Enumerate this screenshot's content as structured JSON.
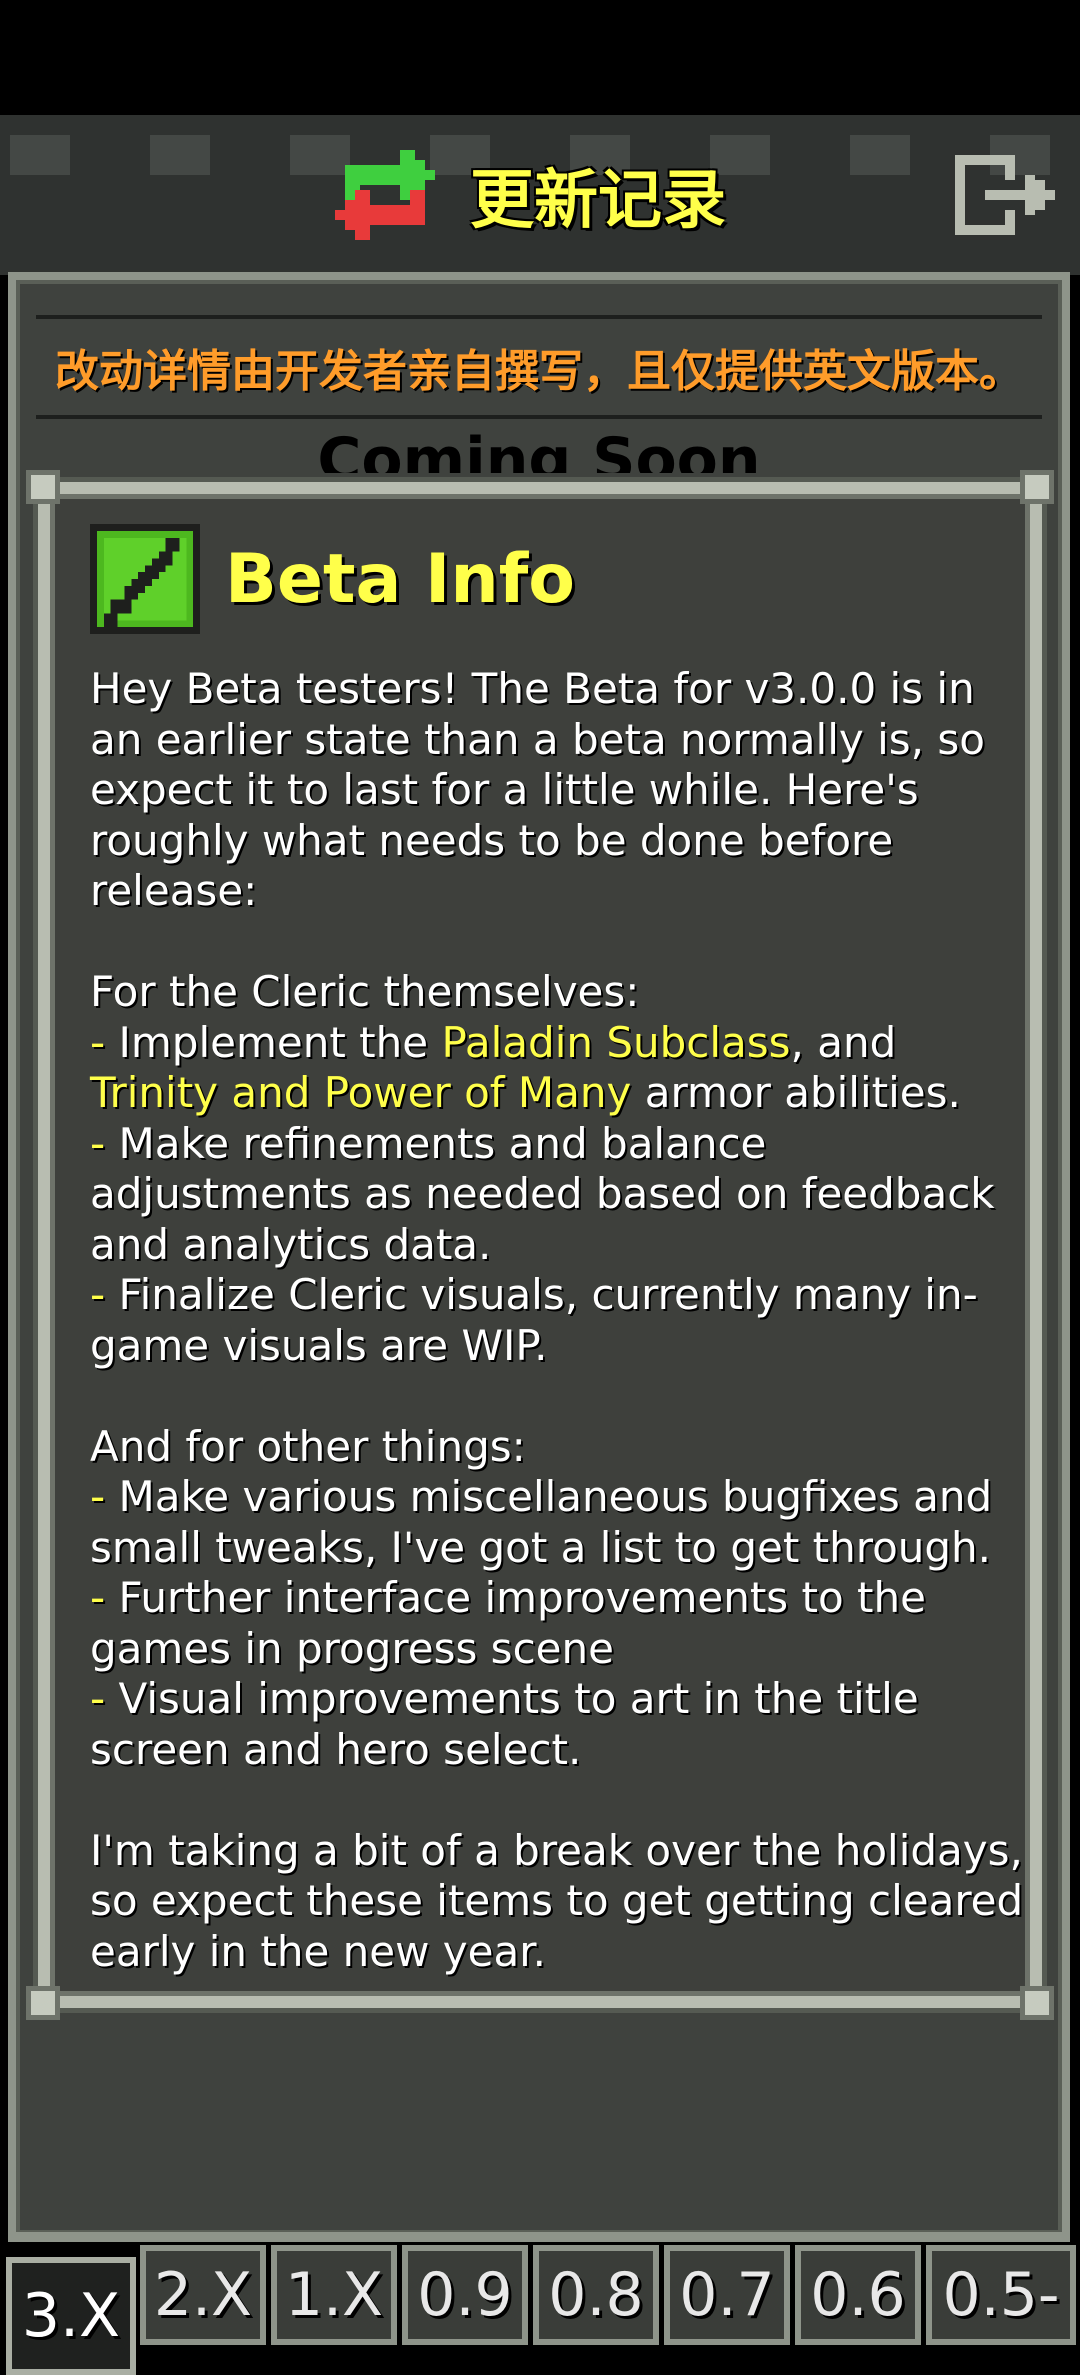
{
  "header": {
    "title": "更新记录",
    "icon": "refresh-arrows-icon",
    "exit_icon": "exit-door-icon"
  },
  "notice": {
    "text": "改动详情由开发者亲自撰写，且仅提供英文版本。",
    "color": "#ff9c2a"
  },
  "behind_popup": {
    "coming_soon": "Coming Soon"
  },
  "popup": {
    "title": "Beta Info",
    "icon": "green-sword-icon",
    "p1": "Hey Beta testers! The Beta for v3.0.0 is in an earlier state than a beta normally is, so expect it to last for a little while. Here's roughly what needs to be done before release:",
    "cleric_heading": "For the Cleric themselves:",
    "dash": "-",
    "b1_pre": " Implement the ",
    "b1_hl1": "Paladin Subclass",
    "b1_mid": ", and ",
    "b1_hl2": "Trinity and Power of Many",
    "b1_post": " armor abilities.",
    "b2": " Make refinements and balance adjustments as needed based on feedback and analytics data.",
    "b3": " Finalize Cleric visuals, currently many in-game visuals are WIP.",
    "other_heading": "And for other things:",
    "b4": " Make various miscellaneous bugfixes and small tweaks, I've got a list to get through.",
    "b5": " Further interface improvements to the games in progress scene",
    "b6": " Visual improvements to art in the title screen and hero select.",
    "p_end": "I'm taking a bit of a break over the holidays, so expect these items to get getting cleared early in the new year.",
    "highlight_color": "#ffff4a"
  },
  "tabs": [
    {
      "label": "3.X",
      "active": true
    },
    {
      "label": "2.X"
    },
    {
      "label": "1.X"
    },
    {
      "label": "0.9"
    },
    {
      "label": "0.8"
    },
    {
      "label": "0.7"
    },
    {
      "label": "0.6"
    },
    {
      "label": "0.5-"
    }
  ]
}
